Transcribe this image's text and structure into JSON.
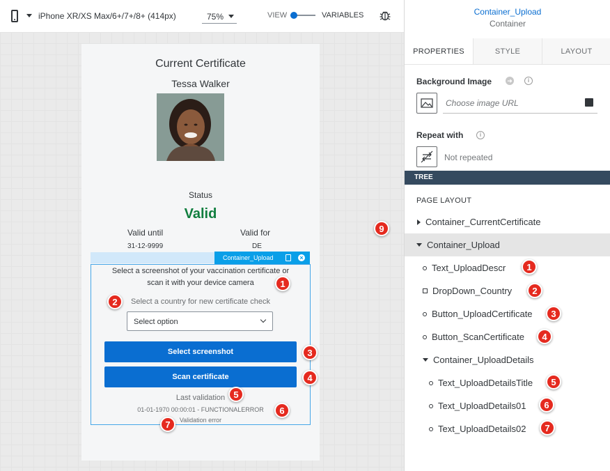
{
  "toolbar": {
    "device_label": "iPhone XR/XS Max/6+/7+/8+ (414px)",
    "zoom_label": "75%",
    "view_label": "VIEW",
    "variables_label": "VARIABLES"
  },
  "phone": {
    "title": "Current Certificate",
    "name": "Tessa Walker",
    "status_label": "Status",
    "status_value": "Valid",
    "status_color": "#107e3e",
    "valid_until_label": "Valid until",
    "valid_until_value": "31-12-9999",
    "valid_for_label": "Valid for",
    "valid_for_value": "DE"
  },
  "selection": {
    "tag_label": "Container_Upload"
  },
  "upload": {
    "description_line1": "Select a screenshot of your vaccination certificate or",
    "description_line2": "scan it with your device camera",
    "country_label": "Select a country for new certificate check",
    "select_placeholder": "Select option",
    "button_upload": "Select screenshot",
    "button_scan": "Scan certificate",
    "last_validation": "Last validation",
    "details01": "01-01-1970 00:00:01 - FUNCTIONALERROR",
    "details02": "Validation error"
  },
  "panel": {
    "title": "Container_Upload",
    "subtitle": "Container",
    "tabs": [
      "PROPERTIES",
      "STYLE",
      "LAYOUT"
    ],
    "background_image_label": "Background Image",
    "image_url_placeholder": "Choose image URL",
    "repeat_with_label": "Repeat with",
    "repeat_value": "Not repeated",
    "tree_label": "TREE",
    "page_layout_label": "PAGE LAYOUT",
    "tree_items": [
      "Container_CurrentCertificate",
      "Container_Upload",
      "Text_UploadDescr",
      "DropDown_Country",
      "Button_UploadCertificate",
      "Button_ScanCertificate",
      "Container_UploadDetails",
      "Text_UploadDetailsTitle",
      "Text_UploadDetails01",
      "Text_UploadDetails02"
    ]
  },
  "markers": [
    "1",
    "2",
    "3",
    "4",
    "5",
    "6",
    "7",
    "9"
  ],
  "colors": {
    "accent": "#0a6ed1",
    "selection": "#0a9fe8",
    "marker": "#e52a1f",
    "tree_bar": "#354a5f"
  }
}
